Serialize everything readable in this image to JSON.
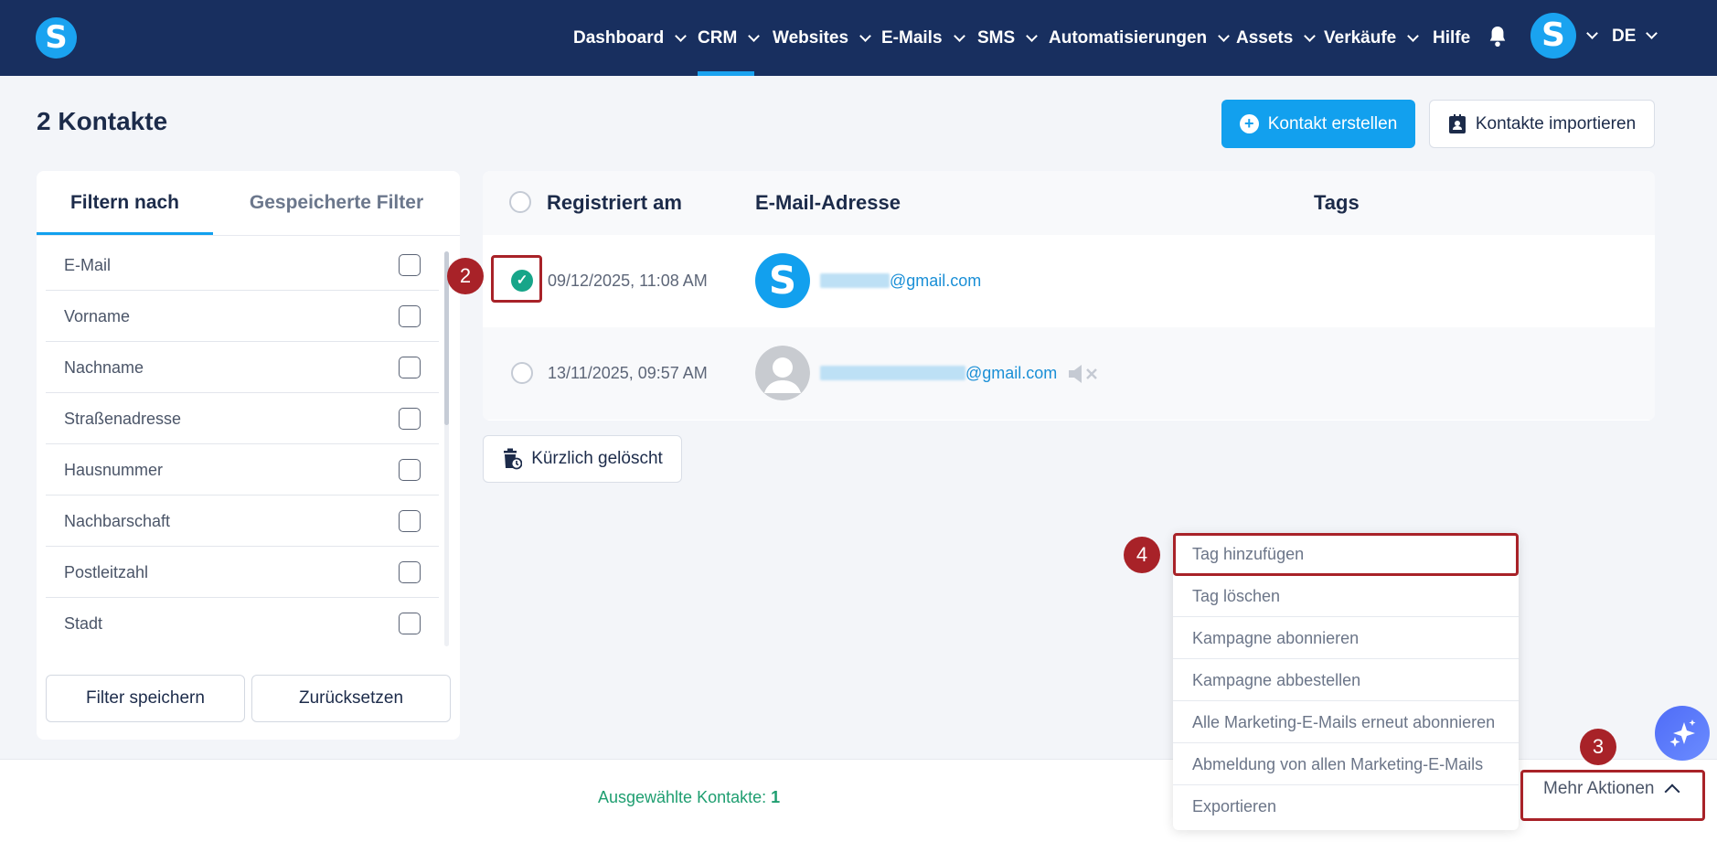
{
  "header": {
    "logo_letter": "S",
    "nav": [
      {
        "label": "Dashboard",
        "has_chevron": true
      },
      {
        "label": "CRM",
        "has_chevron": true,
        "active": true
      },
      {
        "label": "Websites",
        "has_chevron": true
      },
      {
        "label": "E-Mails",
        "has_chevron": true
      },
      {
        "label": "SMS",
        "has_chevron": true
      },
      {
        "label": "Automatisierungen",
        "has_chevron": true
      },
      {
        "label": "Assets",
        "has_chevron": true
      },
      {
        "label": "Verkäufe",
        "has_chevron": true
      },
      {
        "label": "Hilfe",
        "has_chevron": false
      }
    ],
    "avatar_letter": "S",
    "language": "DE",
    "icons": [
      "bell-icon",
      "chevron-down-icon"
    ]
  },
  "page": {
    "title": "2 Kontakte",
    "create_button": "Kontakt erstellen",
    "import_button": "Kontakte importieren"
  },
  "filter": {
    "tabs": [
      "Filtern nach",
      "Gespeicherte Filter"
    ],
    "fields": [
      "E-Mail",
      "Vorname",
      "Nachname",
      "Straßenadresse",
      "Hausnummer",
      "Nachbarschaft",
      "Postleitzahl",
      "Stadt"
    ],
    "save_button": "Filter speichern",
    "reset_button": "Zurücksetzen"
  },
  "table": {
    "columns": [
      "Registriert am",
      "E-Mail-Adresse",
      "Tags"
    ],
    "rows": [
      {
        "date": "09/12/2025, 11:08 AM",
        "email_domain": "@gmail.com",
        "selected": true,
        "avatar": "S"
      },
      {
        "date": "13/11/2025, 09:57 AM",
        "email_domain": "@gmail.com",
        "selected": false,
        "avatar": "default",
        "muted": true
      }
    ]
  },
  "recently_deleted_button": "Kürzlich gelöscht",
  "bottom": {
    "selected_label": "Ausgewählte Kontakte:",
    "selected_count": "1",
    "more_actions": "Mehr Aktionen"
  },
  "dropdown": {
    "items": [
      "Tag hinzufügen",
      "Tag löschen",
      "Kampagne abonnieren",
      "Kampagne abbestellen",
      "Alle Marketing-E-Mails erneut abonnieren",
      "Abmeldung von allen Marketing-E-Mails",
      "Exportieren"
    ]
  },
  "annotations": [
    "2",
    "3",
    "4"
  ],
  "colors": {
    "header_bg": "#182f5f",
    "accent": "#12a0ee",
    "annotation": "#a82228",
    "selected_green": "#17a589"
  }
}
